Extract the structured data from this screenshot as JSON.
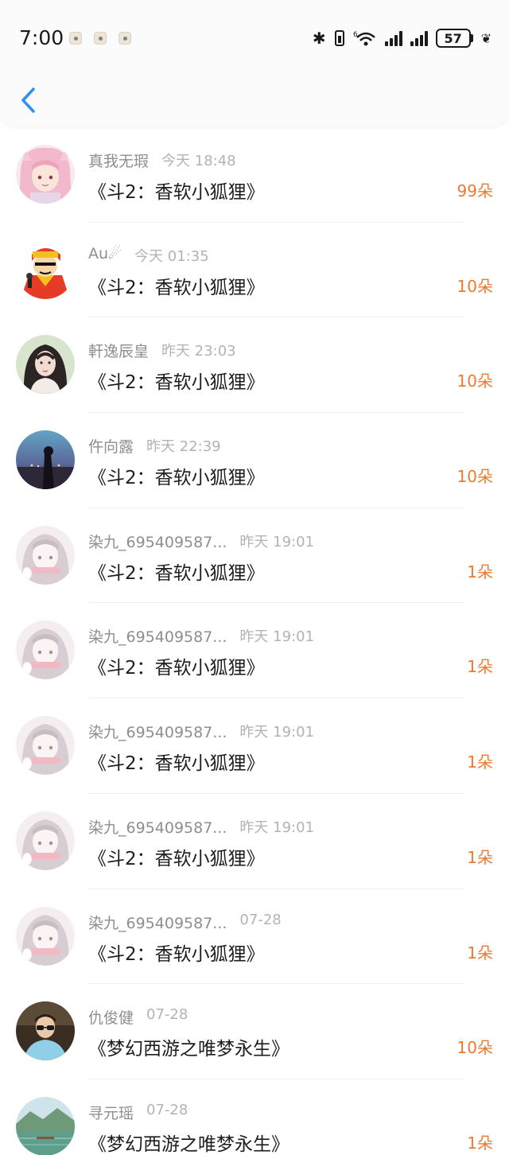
{
  "status_bar": {
    "time": "7:00",
    "battery": "57",
    "notification_icons": [
      "notification-icon",
      "notification-icon",
      "notification-icon"
    ]
  },
  "header": {
    "back_icon": "chevron-left-icon"
  },
  "colors": {
    "accent": "#2f8ff5",
    "amount": "#ee7a2f",
    "name": "#8e8e8e",
    "time": "#b3b3b3"
  },
  "gifts": [
    {
      "user": "真我无瑕",
      "time": "今天 18:48",
      "work": "《斗2：香软小狐狸》",
      "amount": "99朵",
      "avatar": "pink-fox-girl"
    },
    {
      "user": "Au☄",
      "time": "今天 01:35",
      "work": "《斗2：香软小狐狸》",
      "amount": "10朵",
      "avatar": "cartoon-singer"
    },
    {
      "user": "軒逸辰皇",
      "time": "昨天 23:03",
      "work": "《斗2：香软小狐狸》",
      "amount": "10朵",
      "avatar": "dark-hair-girl"
    },
    {
      "user": "仵向露",
      "time": "昨天 22:39",
      "work": "《斗2：香软小狐狸》",
      "amount": "10朵",
      "avatar": "night-silhouette"
    },
    {
      "user": "染九_695409587...",
      "time": "昨天 19:01",
      "work": "《斗2：香软小狐狸》",
      "amount": "1朵",
      "avatar": "faded-anime-girl"
    },
    {
      "user": "染九_695409587...",
      "time": "昨天 19:01",
      "work": "《斗2：香软小狐狸》",
      "amount": "1朵",
      "avatar": "faded-anime-girl"
    },
    {
      "user": "染九_695409587...",
      "time": "昨天 19:01",
      "work": "《斗2：香软小狐狸》",
      "amount": "1朵",
      "avatar": "faded-anime-girl"
    },
    {
      "user": "染九_695409587...",
      "time": "昨天 19:01",
      "work": "《斗2：香软小狐狸》",
      "amount": "1朵",
      "avatar": "faded-anime-girl"
    },
    {
      "user": "染九_695409587...",
      "time": "07-28",
      "work": "《斗2：香软小狐狸》",
      "amount": "1朵",
      "avatar": "faded-anime-girl"
    },
    {
      "user": "仇俊健",
      "time": "07-28",
      "work": "《梦幻西游之唯梦永生》",
      "amount": "10朵",
      "avatar": "man-with-glasses"
    },
    {
      "user": "寻元瑶",
      "time": "07-28",
      "work": "《梦幻西游之唯梦永生》",
      "amount": "1朵",
      "avatar": "lake-landscape"
    }
  ]
}
